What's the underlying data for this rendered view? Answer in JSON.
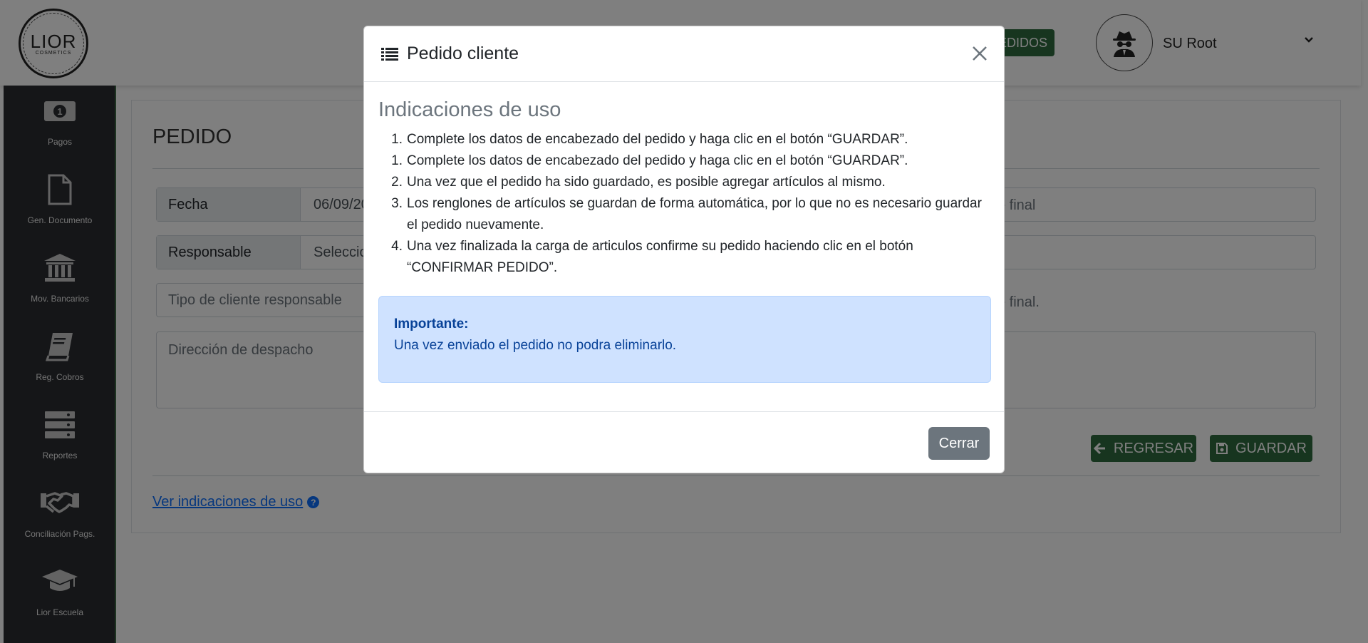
{
  "header": {
    "logo_text": "LIOR",
    "logo_sub": "COSMETICS",
    "pedidos_label": "EDIDOS",
    "user_name": "SU Root"
  },
  "sidebar": {
    "items": [
      {
        "label": "Pagos",
        "icon": "money-bill-icon"
      },
      {
        "label": "Gen. Documento",
        "icon": "file-icon"
      },
      {
        "label": "Mov. Bancarios",
        "icon": "bank-icon"
      },
      {
        "label": "Reg. Cobros",
        "icon": "book-icon"
      },
      {
        "label": "Reportes",
        "icon": "server-icon"
      },
      {
        "label": "Conciliación Pags.",
        "icon": "handshake-icon"
      },
      {
        "label": "Lior Escuela",
        "icon": "graduation-cap-icon"
      }
    ]
  },
  "main": {
    "title": "PEDIDO",
    "fecha_label": "Fecha",
    "fecha_value": "06/09/20",
    "responsable_label": "Responsable",
    "responsable_value": "Seleccion",
    "tipo_cliente_placeholder": "Tipo de cliente responsable",
    "direccion_placeholder": "Dirección de despacho",
    "right_text_1": "e final",
    "right_text_2": "e final.",
    "regresar_label": "REGRESAR",
    "guardar_label": "GUARDAR",
    "help_link": "Ver indicaciones de uso"
  },
  "modal": {
    "title": "Pedido cliente",
    "heading": "Indicaciones de uso",
    "items": [
      {
        "num": "1.",
        "text": "Complete los datos de encabezado del pedido y haga clic en el botón “GUARDAR”."
      },
      {
        "num": "1.",
        "text": "Complete los datos de encabezado del pedido y haga clic en el botón “GUARDAR”."
      },
      {
        "num": "2.",
        "text": "Una vez que el pedido ha sido guardado, es posible agregar artículos al mismo."
      },
      {
        "num": "3.",
        "text": "Los renglones de artículos se guardan de forma automática, por lo que no es necesario guardar el pedido nuevamente."
      },
      {
        "num": "4.",
        "text": "Una vez finalizada la carga de articulos confirme su pedido haciendo clic en el botón “CONFIRMAR PEDIDO”."
      }
    ],
    "alert_title": "Importante:",
    "alert_text": "Una vez enviado el pedido no podra eliminarlo.",
    "close_label": "Cerrar"
  },
  "colors": {
    "accent_green": "#2e6b3f",
    "sidebar_bg": "#2a2d30",
    "alert_bg": "#cfe2ff",
    "alert_text": "#084298",
    "secondary_btn": "#6c757d",
    "link": "#0d6efd"
  }
}
